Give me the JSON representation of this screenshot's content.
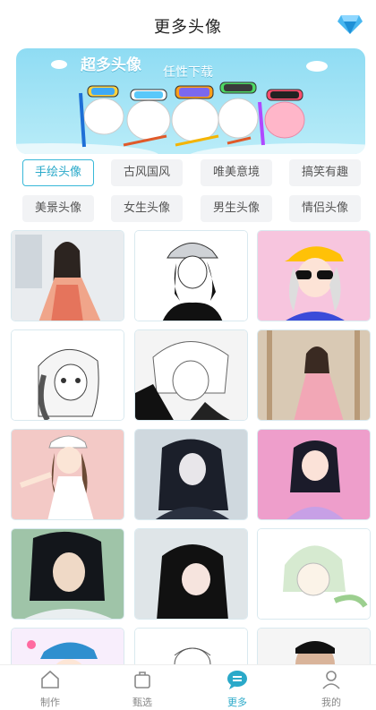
{
  "header": {
    "title": "更多头像",
    "vip_icon": "diamond-icon"
  },
  "banner": {
    "title": "超多头像",
    "subtitle": "任性下载"
  },
  "categories": [
    {
      "label": "手绘头像",
      "active": true
    },
    {
      "label": "古风国风",
      "active": false
    },
    {
      "label": "唯美意境",
      "active": false
    },
    {
      "label": "搞笑有趣",
      "active": false
    },
    {
      "label": "美景头像",
      "active": false
    },
    {
      "label": "女生头像",
      "active": false
    },
    {
      "label": "男生头像",
      "active": false
    },
    {
      "label": "情侣头像",
      "active": false
    }
  ],
  "avatars": [
    {
      "name": "avatar-hanfu-girl"
    },
    {
      "name": "avatar-cap-girl-sketch"
    },
    {
      "name": "avatar-sunglasses-girl"
    },
    {
      "name": "avatar-braid-girl-sketch"
    },
    {
      "name": "avatar-bob-hair-sketch"
    },
    {
      "name": "avatar-hanfu-pink-girl"
    },
    {
      "name": "avatar-cap-girl-posing"
    },
    {
      "name": "avatar-longhair-man"
    },
    {
      "name": "avatar-purple-girl"
    },
    {
      "name": "avatar-ancient-man"
    },
    {
      "name": "avatar-dark-hair-girl"
    },
    {
      "name": "avatar-dino-hood-kid"
    },
    {
      "name": "avatar-blue-cap-kid"
    },
    {
      "name": "avatar-girl-lineart"
    },
    {
      "name": "avatar-man-beard"
    }
  ],
  "tabbar": {
    "items": [
      {
        "label": "制作",
        "icon": "home-icon",
        "active": false
      },
      {
        "label": "甄选",
        "icon": "bag-icon",
        "active": false
      },
      {
        "label": "更多",
        "icon": "chat-bubble-icon",
        "active": true
      },
      {
        "label": "我的",
        "icon": "user-icon",
        "active": false
      }
    ]
  },
  "colors": {
    "accent": "#2aa9c9",
    "banner_sky": "#8fdcf3"
  }
}
